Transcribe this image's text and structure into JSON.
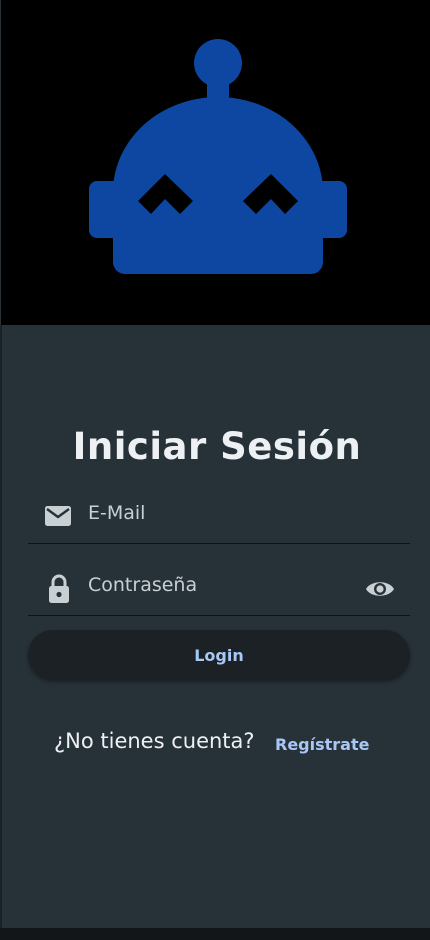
{
  "colors": {
    "header_background": "#000000",
    "panel_background": "#263238",
    "logo_blue": "#0d47a1",
    "button_background": "#1c2126",
    "accent_text": "#a9c7f5",
    "title_text": "#eef1f3",
    "icon_gray": "#c9d0d4"
  },
  "header": {
    "logo_icon": "robot-head-icon"
  },
  "form": {
    "title": "Iniciar Sesión",
    "email": {
      "icon": "mail-icon",
      "placeholder": "E-Mail",
      "value": ""
    },
    "password": {
      "icon": "lock-icon",
      "placeholder": "Contraseña",
      "value": "",
      "toggle_icon": "eye-icon"
    },
    "login_label": "Login"
  },
  "signup": {
    "question": "¿No tienes cuenta?",
    "link_label": "Regístrate"
  }
}
